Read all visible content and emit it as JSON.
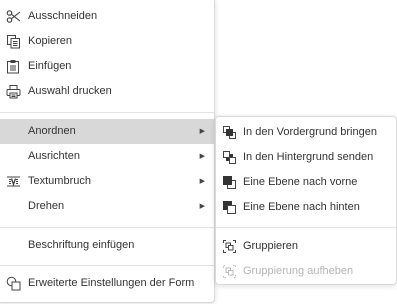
{
  "main_menu": {
    "cut": "Ausschneiden",
    "copy": "Kopieren",
    "paste": "Einfügen",
    "print_selection": "Auswahl drucken",
    "arrange": "Anordnen",
    "align": "Ausrichten",
    "text_wrap": "Textumbruch",
    "rotate": "Drehen",
    "insert_caption": "Beschriftung einfügen",
    "advanced_shape_settings": "Erweiterte Einstellungen der Form"
  },
  "sub_menu": {
    "bring_to_front": "In den Vordergrund bringen",
    "send_to_back": "In den Hintergrund senden",
    "bring_forward": "Eine Ebene nach vorne",
    "send_backward": "Eine Ebene nach hinten",
    "group": "Gruppieren",
    "ungroup": "Gruppierung aufheben"
  },
  "colors": {
    "active_item": "#d8d8d8",
    "disabled_text": "#b5b5b5",
    "icon": "#444444"
  }
}
